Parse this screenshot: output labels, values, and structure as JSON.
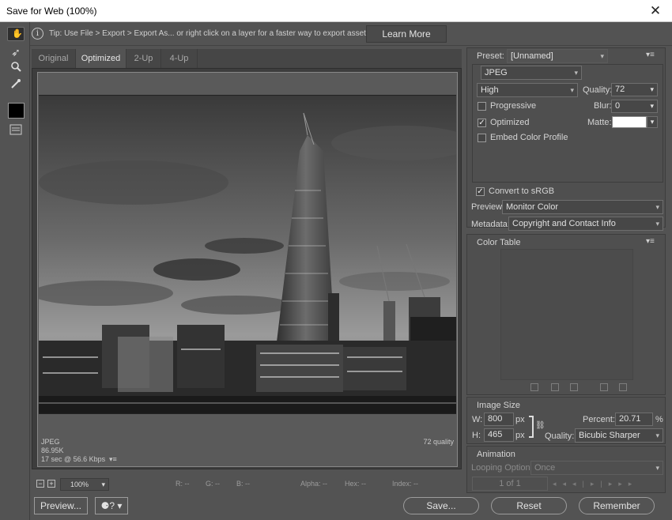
{
  "window": {
    "title": "Save for Web (100%)",
    "close": "✕"
  },
  "tip": {
    "text": "Tip: Use File > Export > Export As...  or right click on a layer for a faster way to export assets",
    "learn_more": "Learn More",
    "icon": "info-icon"
  },
  "tabs": [
    {
      "label": "Original"
    },
    {
      "label": "Optimized"
    },
    {
      "label": "2-Up"
    },
    {
      "label": "4-Up"
    }
  ],
  "image_info": {
    "format": "JPEG",
    "size": "86.95K",
    "time": "17 sec @ 56.6 Kbps",
    "quality": "72 quality"
  },
  "status": {
    "zoom": "100%",
    "r": "R: --",
    "g": "G: --",
    "b": "B: --",
    "alpha": "Alpha: --",
    "hex": "Hex: --",
    "index": "Index: --"
  },
  "preset": {
    "label": "Preset:",
    "value": "[Unnamed]"
  },
  "format": {
    "value": "JPEG"
  },
  "quality_preset": {
    "value": "High"
  },
  "quality": {
    "label": "Quality:",
    "value": "72"
  },
  "blur": {
    "label": "Blur:",
    "value": "0"
  },
  "matte": {
    "label": "Matte:",
    "color": "#ffffff"
  },
  "progressive": {
    "label": "Progressive",
    "checked": false
  },
  "optimized": {
    "label": "Optimized",
    "checked": true
  },
  "embed_profile": {
    "label": "Embed Color Profile",
    "checked": false
  },
  "convert_srgb": {
    "label": "Convert to sRGB",
    "checked": true
  },
  "preview_opt": {
    "label": "Preview:",
    "value": "Monitor Color"
  },
  "metadata": {
    "label": "Metadata:",
    "value": "Copyright and Contact Info"
  },
  "color_table": {
    "title": "Color Table"
  },
  "image_size": {
    "title": "Image Size",
    "w_label": "W:",
    "w_value": "800",
    "h_label": "H:",
    "h_value": "465",
    "unit": "px",
    "percent_label": "Percent:",
    "percent_value": "20.71",
    "percent_unit": "%",
    "quality_label": "Quality:",
    "quality_value": "Bicubic Sharper"
  },
  "animation": {
    "title": "Animation",
    "looping_label": "Looping Options:",
    "looping_value": "Once",
    "frame": "1 of 1"
  },
  "buttons": {
    "preview": "Preview...",
    "save": "Save...",
    "reset": "Reset",
    "remember": "Remember"
  }
}
